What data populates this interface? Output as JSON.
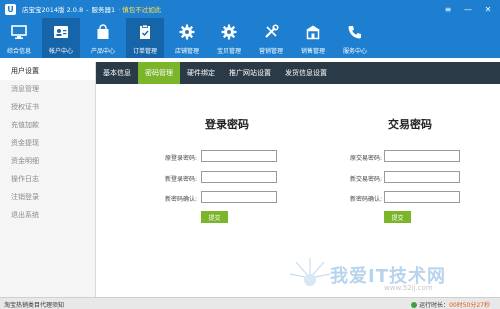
{
  "window": {
    "app_logo": "U",
    "app_name": "店宝宝2014版 2.0.8",
    "separator": "-",
    "server": "服务器1",
    "server_hint": "· 慎包不过如此",
    "buttons": {
      "menu": "≡",
      "minimize": "—",
      "close": "✕"
    }
  },
  "main_nav": [
    {
      "label": "综合信息",
      "icon": "monitor-icon"
    },
    {
      "label": "帐户中心",
      "icon": "user-card-icon",
      "active": true
    },
    {
      "label": "产品中心",
      "icon": "shopping-bag-icon"
    },
    {
      "label": "订单管理",
      "icon": "clipboard-icon",
      "active": true
    },
    {
      "label": "店铺管理",
      "icon": "gear-icon"
    },
    {
      "label": "宝贝管理",
      "icon": "gear-icon"
    },
    {
      "label": "营销管理",
      "icon": "tools-icon"
    },
    {
      "label": "销售管理",
      "icon": "store-icon"
    },
    {
      "label": "服务中心",
      "icon": "phone-icon"
    }
  ],
  "sidebar": [
    {
      "label": "用户设置",
      "active": true
    },
    {
      "label": "消息管理"
    },
    {
      "label": "授权证书"
    },
    {
      "label": "充值加款"
    },
    {
      "label": "资金提现"
    },
    {
      "label": "资金明细"
    },
    {
      "label": "操作日志"
    },
    {
      "label": "注销登录"
    },
    {
      "label": "退出系统"
    }
  ],
  "sub_tabs": [
    {
      "label": "基本信息"
    },
    {
      "label": "密码管理",
      "active": true
    },
    {
      "label": "硬件绑定"
    },
    {
      "label": "推广网站设置"
    },
    {
      "label": "发货信息设置"
    }
  ],
  "login_password": {
    "title": "登录密码",
    "fields": [
      {
        "label": "原登录密码:",
        "value": ""
      },
      {
        "label": "新登录密码:",
        "value": ""
      },
      {
        "label": "新密码确认:",
        "value": ""
      }
    ],
    "submit": "提交"
  },
  "trade_password": {
    "title": "交易密码",
    "fields": [
      {
        "label": "原交易密码:",
        "value": ""
      },
      {
        "label": "新交易密码:",
        "value": ""
      },
      {
        "label": "新密码确认:",
        "value": ""
      }
    ],
    "submit": "提交"
  },
  "watermark": {
    "main": "我爱IT技术网",
    "sub": "www.52ij.com"
  },
  "status_bar": {
    "left": "淘宝热销类目代理须知",
    "runtime_label": "运行时长：",
    "runtime_value": "00时50分27秒"
  },
  "colors": {
    "primary_blue": "#1e7fd0",
    "active_green": "#7ab52a",
    "subtab_bg": "#2b3a47"
  }
}
